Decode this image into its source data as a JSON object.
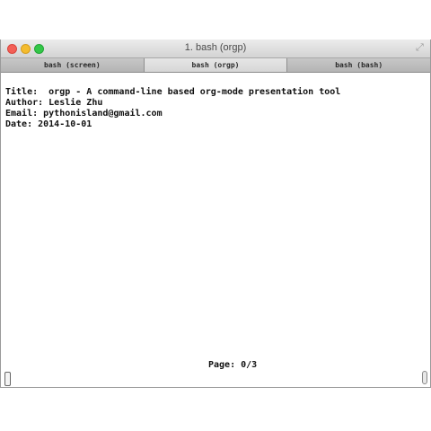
{
  "window": {
    "title": "1. bash (orgp)"
  },
  "tabs": [
    {
      "label": "bash (screen)"
    },
    {
      "label": "bash (orgp)"
    },
    {
      "label": "bash (bash)"
    }
  ],
  "terminal": {
    "lines": [
      "Title:  orgp - A command-line based org-mode presentation tool",
      "Author: Leslie Zhu",
      "Email: pythonisland@gmail.com",
      "Date: 2014-10-01"
    ],
    "page_indicator": "Page: 0/3"
  },
  "colors": {
    "close": "#f35f56",
    "minimize": "#f4bc2e",
    "maximize": "#33c748"
  },
  "icons": {
    "fullscreen": "fullscreen-icon"
  }
}
